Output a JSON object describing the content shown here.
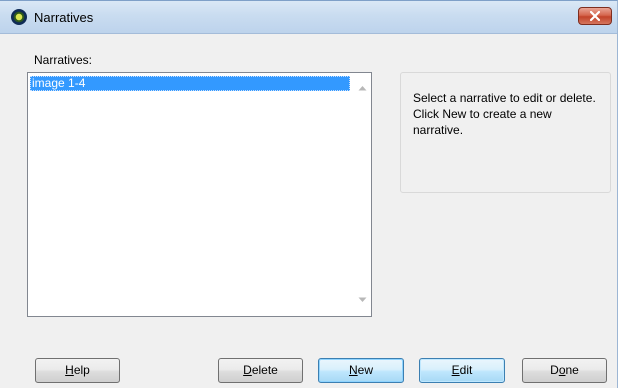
{
  "window": {
    "title": "Narratives",
    "close_icon": "close-icon"
  },
  "list": {
    "label": "Narratives:",
    "items": [
      "image 1-4"
    ],
    "selected_index": 0
  },
  "info": {
    "text": "Select a narrative to edit or delete.  Click New to create a new narrative."
  },
  "buttons": {
    "help": {
      "mnemonic": "H",
      "rest": "elp"
    },
    "delete": {
      "mnemonic": "D",
      "rest": "elete"
    },
    "new": {
      "mnemonic": "N",
      "rest": "ew"
    },
    "edit": {
      "mnemonic": "E",
      "rest": "dit"
    },
    "done": {
      "pre": "D",
      "mnemonic": "o",
      "rest": "ne"
    }
  },
  "colors": {
    "selection": "#3399ff",
    "titlebar": "#c9dcf0",
    "close_button": "#c2432a"
  }
}
